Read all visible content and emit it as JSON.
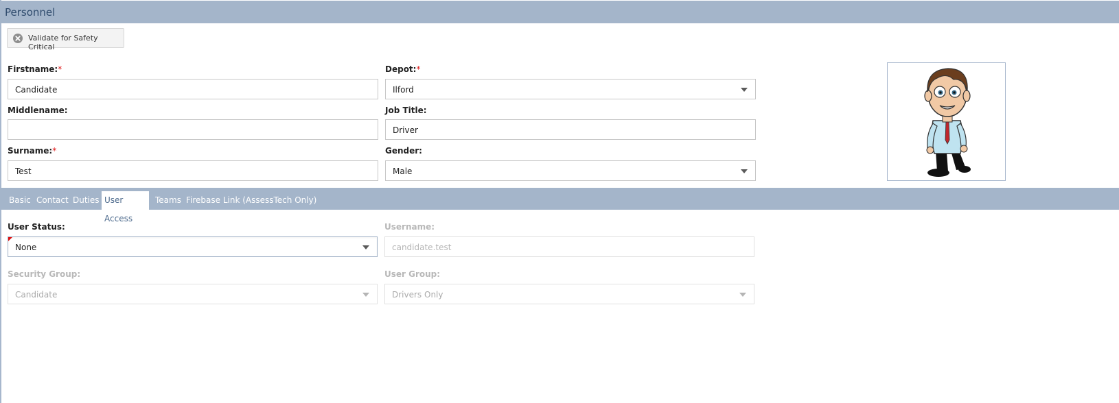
{
  "window": {
    "title": "Personnel"
  },
  "toolbar": {
    "validate_label": "Validate for Safety Critical",
    "validate_icon": "close-circle-icon"
  },
  "form": {
    "firstname": {
      "label": "Firstname:",
      "required": "*",
      "value": "Candidate"
    },
    "middlename": {
      "label": "Middlename:",
      "value": ""
    },
    "surname": {
      "label": "Surname:",
      "required": "*",
      "value": "Test"
    },
    "depot": {
      "label": "Depot:",
      "required": "*",
      "value": "Ilford"
    },
    "job_title": {
      "label": "Job Title:",
      "value": "Driver"
    },
    "gender": {
      "label": "Gender:",
      "value": "Male"
    }
  },
  "avatar": {
    "icon": "cartoon-person-avatar"
  },
  "tabs": [
    {
      "label": "Basic"
    },
    {
      "label": "Contact"
    },
    {
      "label": "Duties"
    },
    {
      "label": "User Access",
      "active": true
    },
    {
      "label": "Teams"
    },
    {
      "label": "Firebase Link (AssessTech Only)"
    }
  ],
  "user_access": {
    "user_status": {
      "label": "User Status:",
      "value": "None"
    },
    "username": {
      "label": "Username:",
      "placeholder": "candidate.test"
    },
    "security_group": {
      "label": "Security Group:",
      "value": "Candidate"
    },
    "user_group": {
      "label": "User Group:",
      "value": "Drivers Only"
    }
  },
  "colors": {
    "header_bg": "#a4b5ca",
    "required": "#dd1111",
    "active_tab_text": "#4f6c8e"
  }
}
